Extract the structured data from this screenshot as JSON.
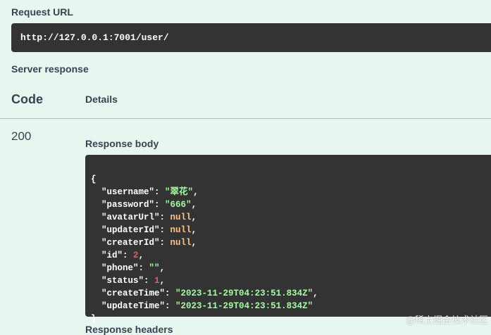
{
  "request_url": {
    "label": "Request URL",
    "value": "http://127.0.0.1:7001/user/"
  },
  "server_response": {
    "label": "Server response",
    "col_code": "Code",
    "col_details": "Details",
    "status_code": "200",
    "response_body_label": "Response body",
    "json": {
      "open_brace": "{",
      "close_brace": "}",
      "fields": [
        {
          "key": "\"username\"",
          "value": "\"翠花\"",
          "type": "str",
          "comma": ","
        },
        {
          "key": "\"password\"",
          "value": "\"666\"",
          "type": "str",
          "comma": ","
        },
        {
          "key": "\"avatarUrl\"",
          "value": "null",
          "type": "nul",
          "comma": ","
        },
        {
          "key": "\"updaterId\"",
          "value": "null",
          "type": "nul",
          "comma": ","
        },
        {
          "key": "\"createrId\"",
          "value": "null",
          "type": "nul",
          "comma": ","
        },
        {
          "key": "\"id\"",
          "value": "2",
          "type": "num",
          "comma": ","
        },
        {
          "key": "\"phone\"",
          "value": "\"\"",
          "type": "str",
          "comma": ","
        },
        {
          "key": "\"status\"",
          "value": "1",
          "type": "num",
          "comma": ","
        },
        {
          "key": "\"createTime\"",
          "value": "\"2023-11-29T04:23:51.834Z\"",
          "type": "str",
          "comma": ","
        },
        {
          "key": "\"updateTime\"",
          "value": "\"2023-11-29T04:23:51.834Z\"",
          "type": "str",
          "comma": ""
        }
      ]
    },
    "next_section_label": "Response headers"
  },
  "watermark": "@稀土掘金技术社区",
  "colors": {
    "background": "#e8f6f0",
    "code_bg": "#333333",
    "string": "#a2fca2",
    "null": "#fcc28c",
    "number": "#d36363"
  }
}
